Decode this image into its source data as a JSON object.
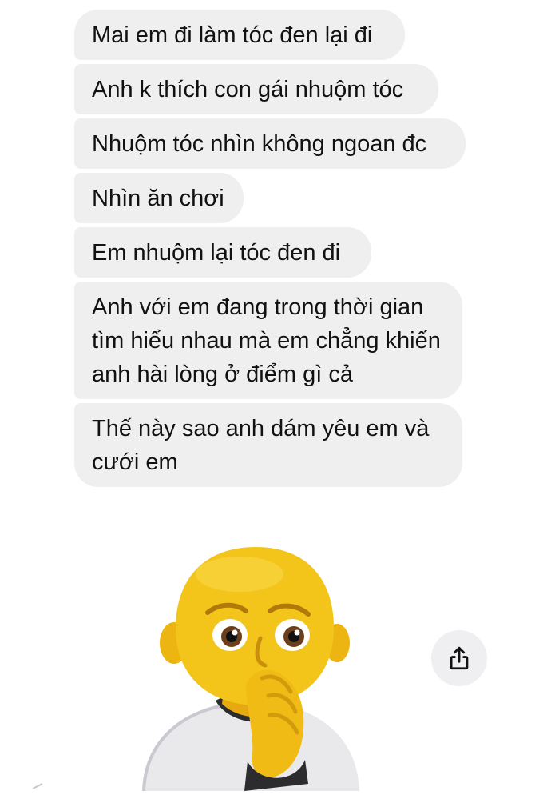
{
  "conversation": {
    "messages": [
      {
        "text": "Mai em đi làm tóc đen lại đi"
      },
      {
        "text": "Anh k thích con gái nhuộm tóc"
      },
      {
        "text": "Nhuộm tóc nhìn không ngoan đc"
      },
      {
        "text": "Nhìn ăn chơi"
      },
      {
        "text": "Em nhuộm lại tóc đen đi"
      },
      {
        "text": "Anh với em đang trong thời gian tìm hiểu nhau mà em chẳng khiến anh hài lòng ở điểm gì cả"
      },
      {
        "text": "Thế này sao anh dám yêu em và cưới em"
      }
    ],
    "bubble_color": "#efeff0",
    "text_color": "#111111"
  },
  "sticker": {
    "icon": "worried-nail-biting-memoji",
    "skin_color": "#f3c51b"
  },
  "actions": {
    "share_icon": "share-icon"
  }
}
